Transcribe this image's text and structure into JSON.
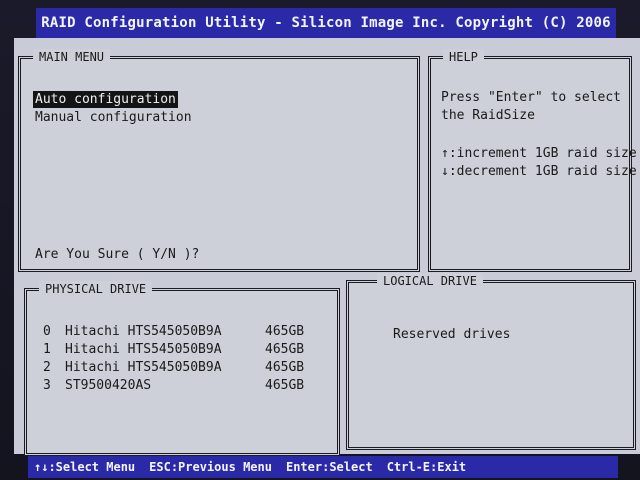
{
  "title_bar": {
    "text": "RAID Configuration Utility - Silicon Image Inc. Copyright (C) 2006"
  },
  "main_menu": {
    "title": "MAIN MENU",
    "items": [
      {
        "label": "Auto configuration",
        "selected": true
      },
      {
        "label": "Manual configuration",
        "selected": false
      }
    ],
    "confirm_prompt": "Are You Sure ( Y/N )?"
  },
  "help": {
    "title": "HELP",
    "lines": [
      "Press \"Enter\" to select",
      "the RaidSize",
      "↑:increment 1GB raid size",
      "↓:decrement 1GB raid size"
    ]
  },
  "physical_drive": {
    "title": "PHYSICAL DRIVE",
    "drives": [
      {
        "index": "0",
        "model": "Hitachi HTS545050B9A",
        "size": "465GB"
      },
      {
        "index": "1",
        "model": "Hitachi HTS545050B9A",
        "size": "465GB"
      },
      {
        "index": "2",
        "model": "Hitachi HTS545050B9A",
        "size": "465GB"
      },
      {
        "index": "3",
        "model": "ST9500420AS",
        "size": "465GB"
      }
    ]
  },
  "logical_drive": {
    "title": "LOGICAL DRIVE",
    "content": "Reserved drives"
  },
  "status_bar": {
    "items": [
      "↑↓:Select Menu",
      "ESC:Previous Menu",
      "Enter:Select",
      "Ctrl-E:Exit"
    ]
  },
  "colors": {
    "accent_blue": "#2a2aa8",
    "panel_gray": "#cdd0d9",
    "text_dark": "#1a1a1a"
  }
}
